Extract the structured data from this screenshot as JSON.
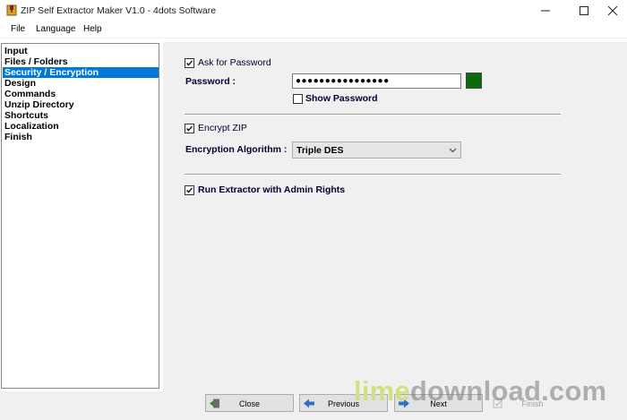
{
  "window": {
    "title": "ZIP Self Extractor Maker V1.0 - 4dots Software"
  },
  "menu": [
    {
      "label": "File"
    },
    {
      "label": "Language"
    },
    {
      "label": "Help"
    }
  ],
  "sidebar": {
    "items": [
      {
        "label": "Input",
        "selected": false
      },
      {
        "label": "Files / Folders",
        "selected": false
      },
      {
        "label": "Security / Encryption",
        "selected": true
      },
      {
        "label": "Design",
        "selected": false
      },
      {
        "label": "Commands",
        "selected": false
      },
      {
        "label": "Unzip Directory",
        "selected": false
      },
      {
        "label": "Shortcuts",
        "selected": false
      },
      {
        "label": "Localization",
        "selected": false
      },
      {
        "label": "Finish",
        "selected": false
      }
    ]
  },
  "security": {
    "ask_password_label": "Ask for Password",
    "ask_password_checked": true,
    "password_label": "Password :",
    "password_value": "●●●●●●●●●●●●●●●●",
    "password_color": "#0b6b0b",
    "show_password_label": "Show Password",
    "show_password_checked": false,
    "encrypt_zip_label": "Encrypt ZIP",
    "encrypt_zip_checked": true,
    "algorithm_label": "Encryption Algorithm :",
    "algorithm_value": "Triple DES",
    "admin_rights_label": "Run Extractor with Admin Rights",
    "admin_rights_checked": true
  },
  "footer": {
    "close_label": "Close",
    "previous_label": "Previous",
    "next_label": "Next",
    "finish_label": "Finish"
  },
  "watermark": {
    "part1": "lime",
    "part2": "download.com"
  },
  "colors": {
    "selection": "#0078d7",
    "panel_bg": "#f0f0f0",
    "label_text": "#000033"
  }
}
